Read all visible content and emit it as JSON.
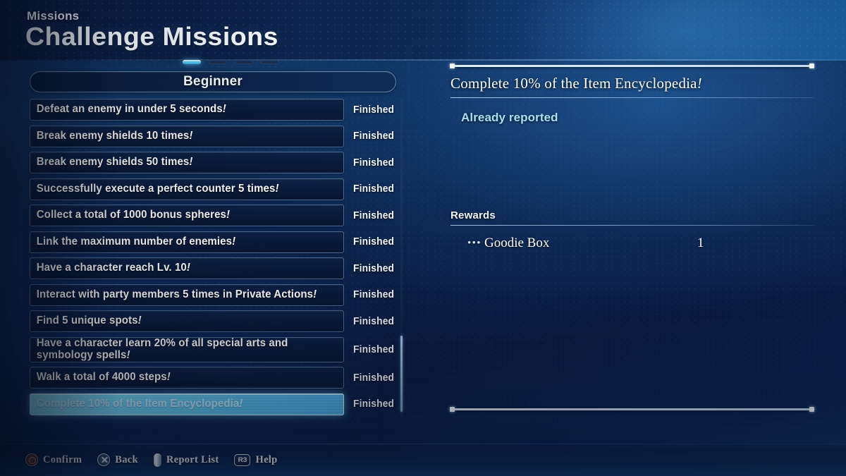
{
  "header": {
    "subtitle": "Missions",
    "title": "Challenge Missions"
  },
  "tabs": {
    "count": 4,
    "active_index": 0,
    "active_color": "#6ed2ff",
    "inactive_color": "#1b3459"
  },
  "category": {
    "label": "Beginner"
  },
  "mission_list": {
    "status_label": "Finished",
    "items": [
      {
        "name": "Defeat an enemy in under 5 seconds",
        "status": "Finished",
        "selected": false
      },
      {
        "name": "Break enemy shields 10 times",
        "status": "Finished",
        "selected": false
      },
      {
        "name": "Break enemy shields 50 times",
        "status": "Finished",
        "selected": false
      },
      {
        "name": "Successfully execute a perfect counter 5 times",
        "status": "Finished",
        "selected": false
      },
      {
        "name": "Collect a total of 1000 bonus spheres",
        "status": "Finished",
        "selected": false
      },
      {
        "name": "Link the maximum number of enemies",
        "status": "Finished",
        "selected": false
      },
      {
        "name": "Have a character reach Lv. 10",
        "status": "Finished",
        "selected": false
      },
      {
        "name": "Interact with party members 5 times in Private Actions",
        "status": "Finished",
        "selected": false
      },
      {
        "name": "Find 5 unique spots",
        "status": "Finished",
        "selected": false
      },
      {
        "name": "Have a character learn 20% of all special arts and\nsymbology spells",
        "status": "Finished",
        "selected": false
      },
      {
        "name": "Walk a total of 4000 steps",
        "status": "Finished",
        "selected": false
      },
      {
        "name": "Complete 10% of the Item Encyclopedia",
        "status": "Finished",
        "selected": true
      }
    ]
  },
  "detail": {
    "title": "Complete 10% of the Item Encyclopedia",
    "status": "Already reported",
    "status_color": "#a8e0f5",
    "rewards_label": "Rewards",
    "rewards": [
      {
        "bullet": "•••",
        "name": "Goodie Box",
        "quantity": "1"
      }
    ]
  },
  "footer": {
    "buttons": [
      {
        "icon": "playstation-circle-icon",
        "label": "Confirm"
      },
      {
        "icon": "playstation-cross-icon",
        "label": "Back"
      },
      {
        "icon": "analog-stick-icon",
        "label": "Report List"
      },
      {
        "icon": "r3-button-icon",
        "label": "Help"
      }
    ]
  }
}
